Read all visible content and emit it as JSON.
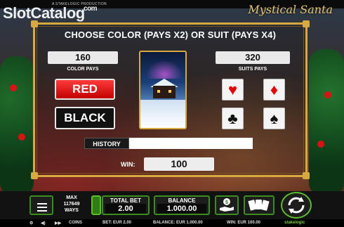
{
  "header": {
    "producer": "A STAKELOGIC PRODUCTION",
    "watermark": "SlotCatalog",
    "watermark_com": ".com",
    "game_logo": "Mystical Santa"
  },
  "gamble": {
    "title": "CHOOSE COLOR (PAYS X2) OR SUIT (PAYS X4)",
    "color_pays_value": "160",
    "color_pays_label": "COLOR PAYS",
    "suits_pays_value": "320",
    "suits_pays_label": "SUITS PAYS",
    "red_label": "RED",
    "black_label": "BLACK",
    "suits": [
      {
        "name": "hearts",
        "symbol": "♥"
      },
      {
        "name": "diamonds",
        "symbol": "♦"
      },
      {
        "name": "clubs",
        "symbol": "♣"
      },
      {
        "name": "spades",
        "symbol": "♠"
      }
    ],
    "history_label": "HISTORY",
    "win_label": "WIN:",
    "win_value": "100"
  },
  "bottom_bar": {
    "max_ways_line1": "MAX",
    "max_ways_line2": "117649",
    "max_ways_line3": "WAYS",
    "total_bet_label": "TOTAL BET",
    "total_bet_value": "2.00",
    "balance_label": "BALANCE",
    "balance_value": "1.000.00"
  },
  "footer": {
    "coins_label": "COINS",
    "bet_text": "BET: EUR 2.00",
    "balance_text": "BALANCE: EUR 1.000.00",
    "win_text": "WIN: EUR 100.00",
    "brand": "stakelogic"
  },
  "colors": {
    "gold": "#d7a93f",
    "red_button": "#e00000",
    "green_accent": "#3a8e1e"
  }
}
